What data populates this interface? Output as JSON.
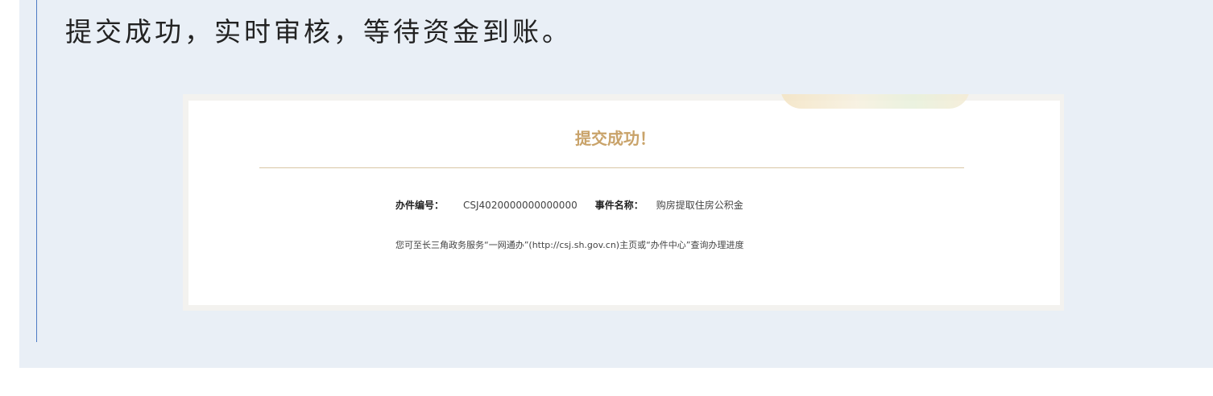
{
  "headline": "提交成功，实时审核，等待资金到账。",
  "result_card": {
    "title": "提交成功！",
    "case_number_label": "办件编号：",
    "case_number_value": "CSJ4020000000000000",
    "event_name_label": "事件名称：",
    "event_name_value": "购房提取住房公积金",
    "note": "您可至长三角政务服务“一网通办”(http://csj.sh.gov.cn)主页或“办件中心”查询办理进度"
  },
  "colors": {
    "panel_bg": "#e9eff6",
    "accent_line": "#4d7cc4",
    "success_title": "#c9a36a",
    "divider": "#d9c6a5"
  }
}
